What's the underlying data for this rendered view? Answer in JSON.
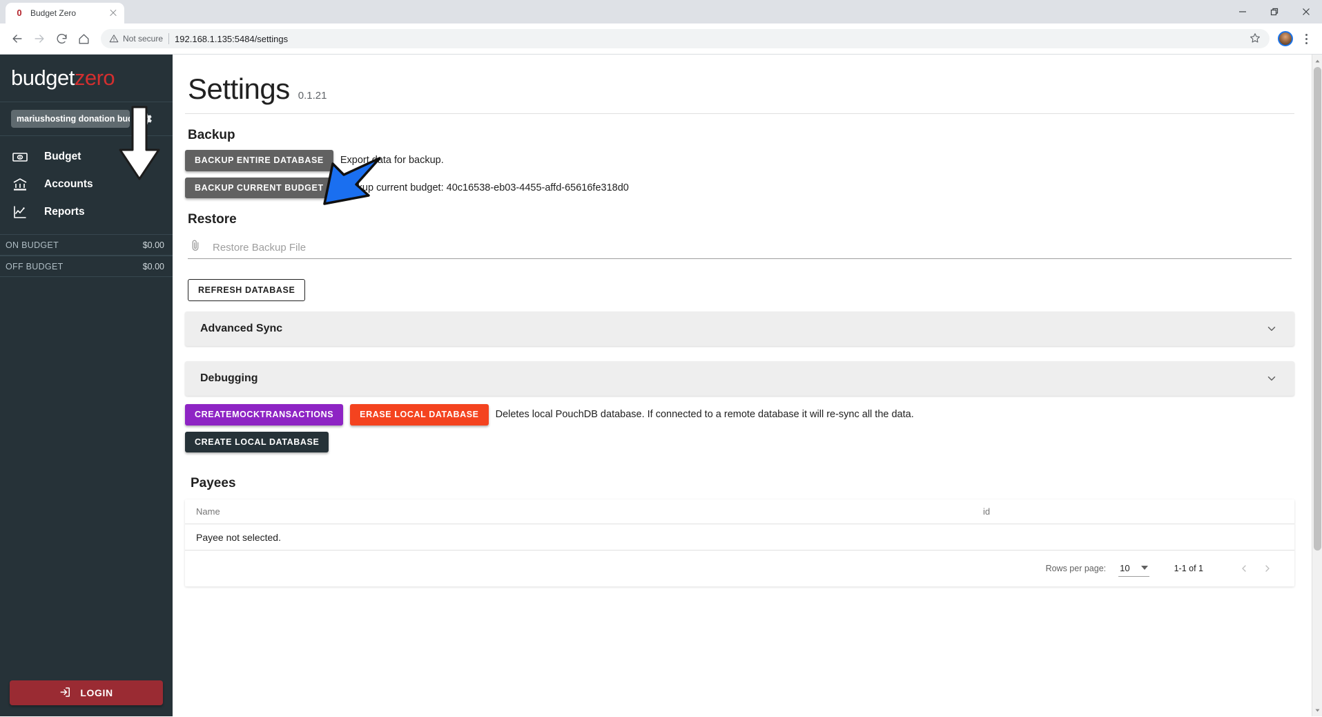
{
  "browser": {
    "tab": {
      "title": "Budget Zero",
      "favicon_glyph": "0"
    },
    "nav": {
      "back": "←",
      "forward": "→",
      "reload": "⟳",
      "home": "⌂"
    },
    "omnibox": {
      "security_label": "Not secure",
      "url": "192.168.1.135:5484/settings"
    },
    "window": {
      "minimize": "—",
      "maximize": "❐",
      "close": "✕"
    }
  },
  "sidebar": {
    "brand": {
      "part1": "budget",
      "part2": "zero"
    },
    "budget_chip": "mariushosting donation budget",
    "gear_icon": "gear-icon",
    "nav_items": [
      {
        "label": "Budget",
        "icon": "money-icon"
      },
      {
        "label": "Accounts",
        "icon": "bank-icon"
      },
      {
        "label": "Reports",
        "icon": "chart-line-icon"
      }
    ],
    "totals": [
      {
        "label": "ON BUDGET",
        "value": "$0.00"
      },
      {
        "label": "OFF BUDGET",
        "value": "$0.00"
      }
    ],
    "login_label": "LOGIN"
  },
  "page": {
    "title": "Settings",
    "version": "0.1.21"
  },
  "backup": {
    "heading": "Backup",
    "entire_db_button": "BACKUP ENTIRE DATABASE",
    "entire_db_hint": "Export data for backup.",
    "current_budget_button": "BACKUP CURRENT BUDGET",
    "current_budget_hint": "Backup current budget: 40c16538-eb03-4455-affd-65616fe318d0"
  },
  "restore": {
    "heading": "Restore",
    "file_placeholder": "Restore Backup File",
    "refresh_button": "REFRESH DATABASE"
  },
  "advanced_sync": {
    "title": "Advanced Sync",
    "expand_icon": "chevron-down-icon"
  },
  "debugging": {
    "title": "Debugging",
    "expand_icon": "chevron-down-icon",
    "mock_button": "CREATEMOCKTRANSACTIONS",
    "erase_button": "ERASE LOCAL DATABASE",
    "erase_hint": "Deletes local PouchDB database. If connected to a remote database it will re-sync all the data.",
    "create_button": "CREATE LOCAL DATABASE"
  },
  "payees": {
    "heading": "Payees",
    "columns": [
      "Name",
      "id"
    ],
    "empty_message": "Payee not selected.",
    "rows_per_page_label": "Rows per page:",
    "rows_per_page_value": "10",
    "range_label": "1-1 of 1",
    "prev_icon": "chevron-left-icon",
    "next_icon": "chevron-right-icon"
  },
  "colors": {
    "sidebar_bg": "#263238",
    "brand_accent": "#d32f2f",
    "login_bg": "#9a2b33",
    "btn_grey": "#616161",
    "btn_purple": "#8e24c4",
    "btn_red": "#f4431f",
    "btn_dark": "#263238",
    "annotation_blue": "#1a6ff0"
  }
}
